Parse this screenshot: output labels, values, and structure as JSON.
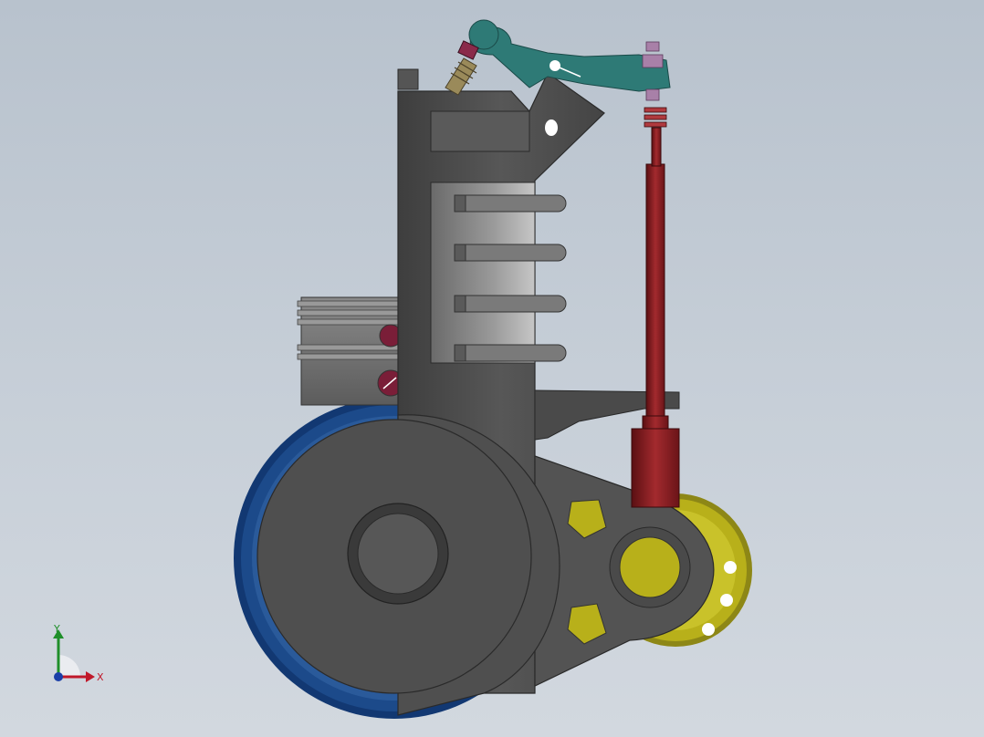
{
  "viewport": {
    "background_top": "#b8c2cd",
    "background_bottom": "#d2d8df"
  },
  "model": {
    "body_color": "#4d4d4d",
    "gear_blue": "#1c4a8a",
    "gear_yellow": "#b8b01a",
    "pushrod_red": "#8b1e22",
    "rocker_teal": "#2e7a76",
    "spring_color": "#9a8a5a",
    "nut_color": "#a880a8"
  },
  "triad": {
    "x_label": "X",
    "y_label": "Y",
    "x_color": "#c0182a",
    "y_color": "#1f8f2a",
    "z_color": "#1a3fa8"
  }
}
